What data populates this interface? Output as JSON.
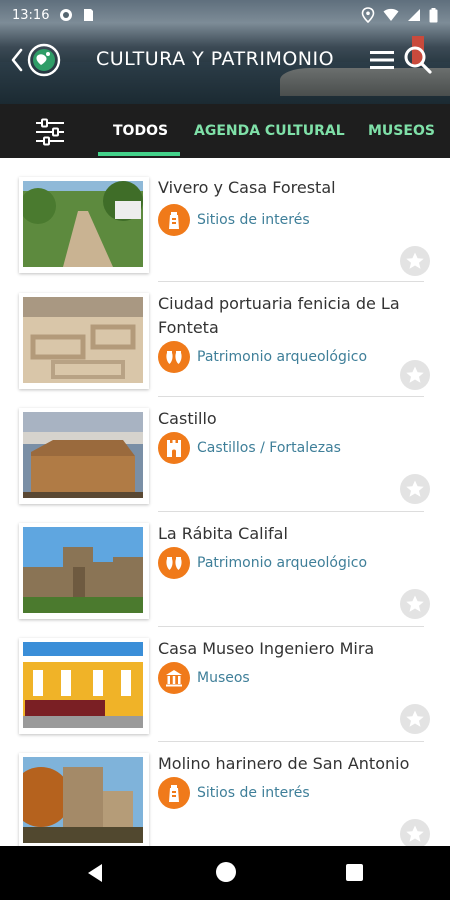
{
  "status": {
    "time": "13:16"
  },
  "header": {
    "title": "CULTURA Y PATRIMONIO"
  },
  "tabs": [
    {
      "label": "TODOS",
      "active": true
    },
    {
      "label": "AGENDA CULTURAL",
      "active": false
    },
    {
      "label": "MUSEOS",
      "active": false
    }
  ],
  "colors": {
    "accent_green": "#43d28a",
    "tab_inactive": "#7fe0a8",
    "category_orange": "#f07a1a",
    "category_text": "#3f7f99"
  },
  "items": [
    {
      "title": "Vivero y Casa Forestal",
      "category": "Sitios de interés",
      "category_icon": "tower-icon"
    },
    {
      "title": "Ciudad portuaria fenicia de La Fonteta",
      "category": "Patrimonio arqueológico",
      "category_icon": "amphora-icon"
    },
    {
      "title": "Castillo",
      "category": "Castillos / Fortalezas",
      "category_icon": "castle-icon"
    },
    {
      "title": "La Rábita Califal",
      "category": "Patrimonio arqueológico",
      "category_icon": "amphora-icon"
    },
    {
      "title": "Casa Museo Ingeniero Mira",
      "category": "Museos",
      "category_icon": "museum-icon"
    },
    {
      "title": "Molino harinero de San Antonio",
      "category": "Sitios de interés",
      "category_icon": "tower-icon"
    }
  ]
}
